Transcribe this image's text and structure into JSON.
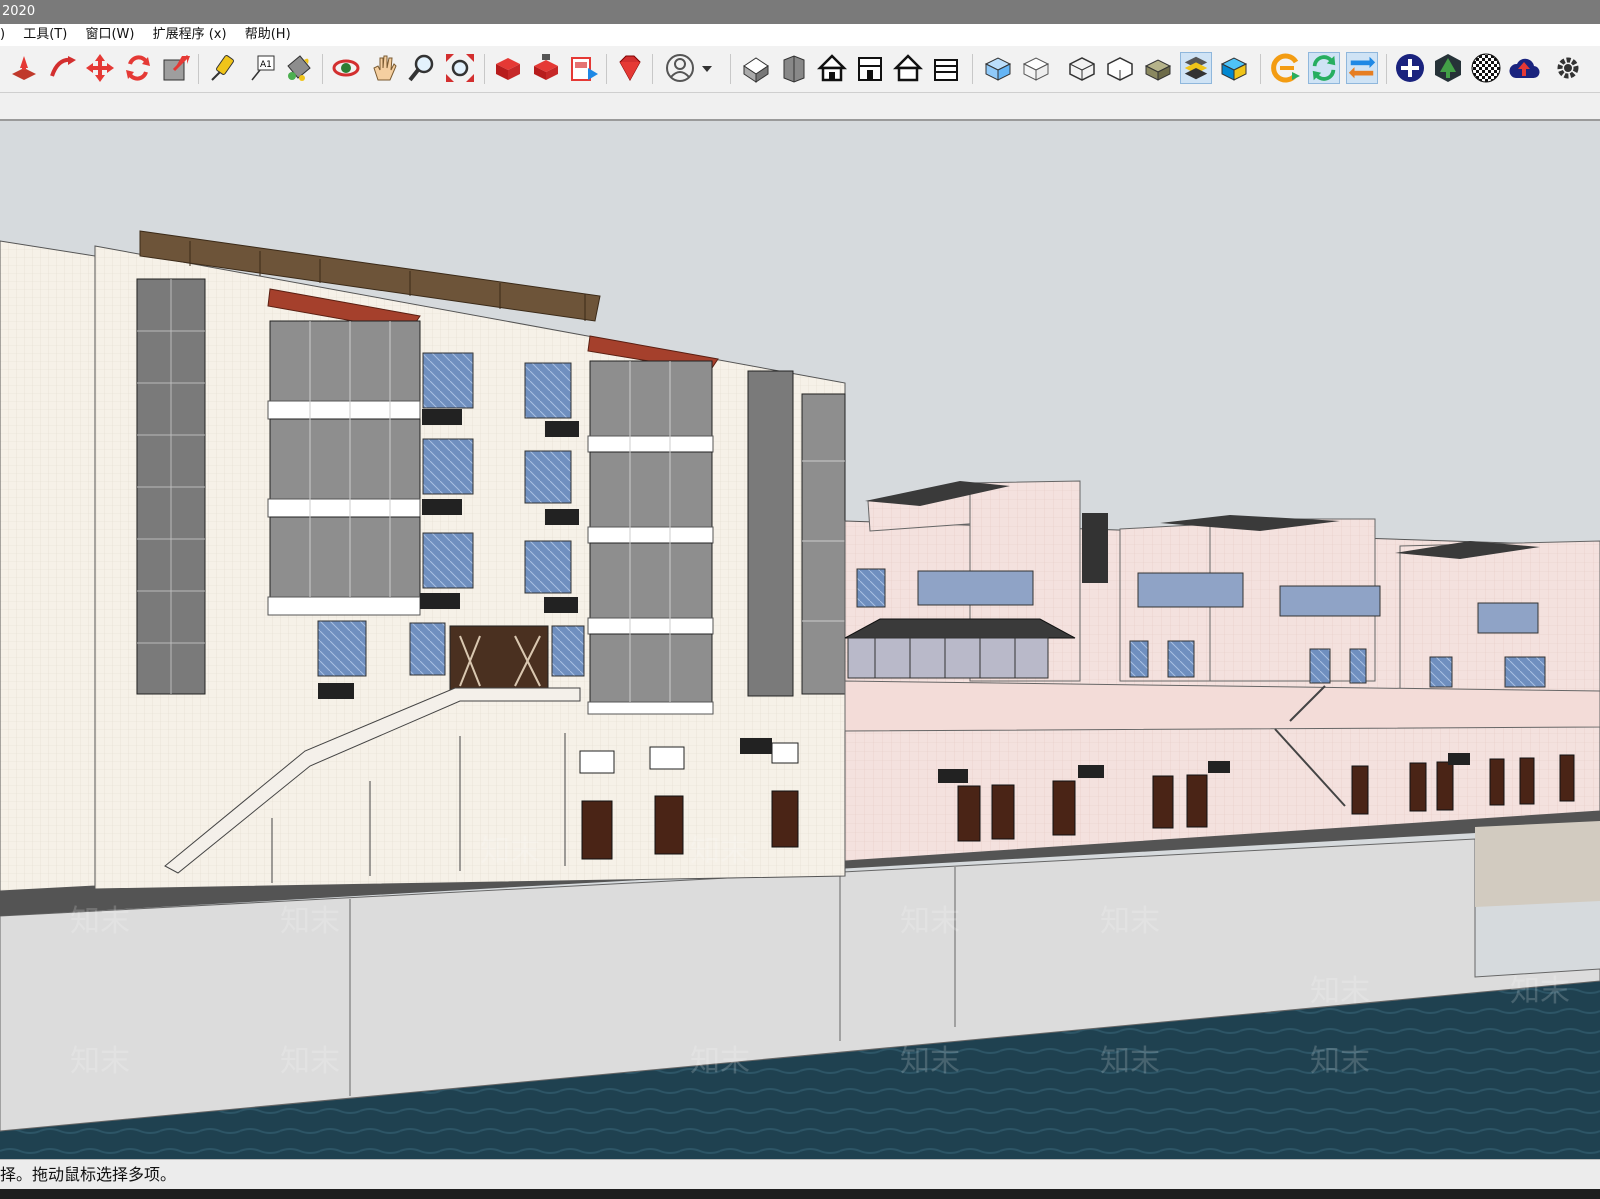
{
  "window": {
    "title": "2020"
  },
  "menu": {
    "items": [
      "工具(T)",
      "窗口(W)",
      "扩展程序 (x)",
      "帮助(H)"
    ]
  },
  "toolbar": {
    "buttons": [
      "push-pull-icon",
      "follow-me-icon",
      "move-icon",
      "rotate-icon",
      "scale-icon",
      "tape-measure-icon",
      "text-label-icon",
      "paint-bucket-icon",
      "orbit-icon",
      "pan-icon",
      "zoom-icon",
      "zoom-extents-icon",
      "3d-warehouse-icon",
      "extension-warehouse-icon",
      "layout-send-icon",
      "ruby-console-icon",
      "account-icon",
      "iso-view-icon",
      "top-view-icon",
      "front-view-icon",
      "right-view-icon",
      "back-view-icon",
      "left-view-icon",
      "xray-style-icon",
      "back-edges-icon",
      "wireframe-icon",
      "hidden-line-icon",
      "shaded-icon",
      "shaded-textures-icon",
      "monochrome-icon",
      "plugin-e-icon",
      "refresh-icon",
      "switch-icon",
      "add-icon",
      "tree-icon",
      "checker-icon",
      "cloud-upload-icon",
      "settings-icon"
    ]
  },
  "viewport": {
    "watermark": "知末",
    "sky_color": "#d6dadd",
    "wall_color": "#f3ede4",
    "pink_wall_color": "#f2dedd",
    "water_color": "#1f4150"
  },
  "status": {
    "text": "择。拖动鼠标选择多项。"
  }
}
